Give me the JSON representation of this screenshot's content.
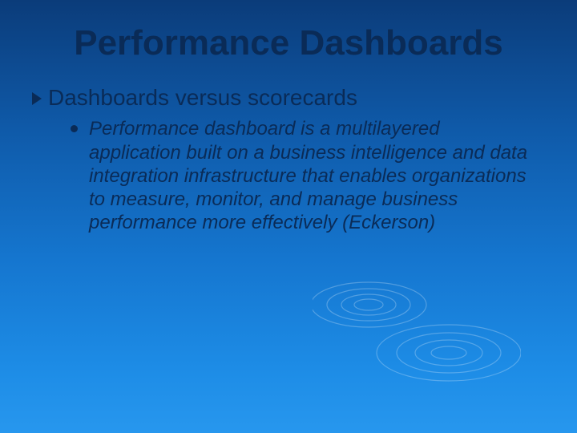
{
  "slide": {
    "title": "Performance Dashboards",
    "subhead": "Dashboards versus scorecards",
    "body": "Performance dashboard is a multilayered application built on a business intelligence and data integration infrastructure that enables organizations to measure, monitor, and manage business performance more effectively  (Eckerson)"
  }
}
